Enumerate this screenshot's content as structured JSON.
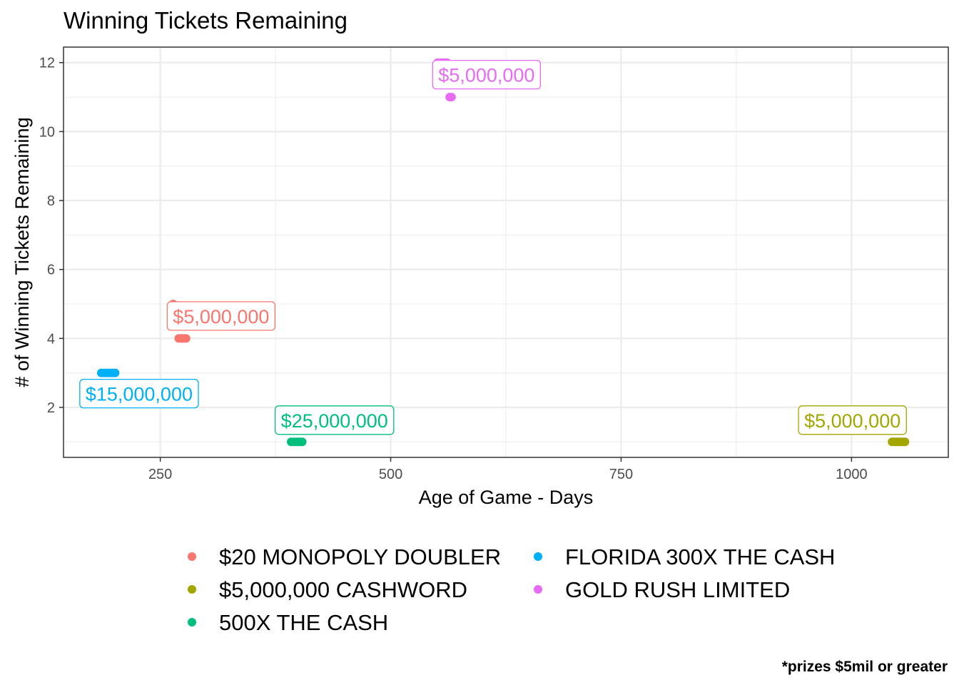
{
  "chart_data": {
    "type": "scatter",
    "title": "Winning Tickets Remaining",
    "xlabel": "Age of Game - Days",
    "ylabel": "# of Winning Tickets Remaining",
    "caption": "*prizes $5mil or greater",
    "xlim": [
      145,
      1105
    ],
    "ylim": [
      0.55,
      12.45
    ],
    "x_ticks": [
      250,
      500,
      750,
      1000
    ],
    "y_ticks": [
      2,
      4,
      6,
      8,
      10,
      12
    ],
    "grid": true,
    "legend_position": "bottom",
    "series": [
      {
        "name": "$20 MONOPOLY DOUBLER",
        "color": "#F8766D",
        "points": [
          [
            264,
            5
          ],
          [
            270,
            4
          ],
          [
            272,
            4
          ],
          [
            274,
            4
          ],
          [
            276,
            4
          ],
          [
            278,
            4
          ]
        ],
        "label": "$5,000,000",
        "label_anchor": [
          316,
          4.65
        ]
      },
      {
        "name": "$5,000,000 CASHWORD",
        "color": "#A3A500",
        "points": [
          [
            1044,
            1
          ],
          [
            1046,
            1
          ],
          [
            1048,
            1
          ],
          [
            1050,
            1
          ],
          [
            1052,
            1
          ],
          [
            1054,
            1
          ],
          [
            1056,
            1
          ],
          [
            1058,
            1
          ]
        ],
        "label": "$5,000,000",
        "label_anchor": [
          1001,
          1.63
        ]
      },
      {
        "name": "500X THE CASH",
        "color": "#00BF7D",
        "points": [
          [
            392,
            1
          ],
          [
            395,
            1
          ],
          [
            398,
            1
          ],
          [
            400,
            1
          ],
          [
            402,
            1
          ],
          [
            404,
            1
          ]
        ],
        "label": "$25,000,000",
        "label_anchor": [
          439,
          1.63
        ]
      },
      {
        "name": "FLORIDA 300X THE CASH",
        "color": "#00B0F6",
        "points": [
          [
            186,
            3
          ],
          [
            189,
            3
          ],
          [
            192,
            3
          ],
          [
            195,
            3
          ],
          [
            198,
            3
          ],
          [
            201,
            3
          ]
        ],
        "label": "$15,000,000",
        "label_anchor": [
          227,
          2.4
        ]
      },
      {
        "name": "GOLD RUSH LIMITED",
        "color": "#E76BF3",
        "points": [
          [
            551,
            12
          ],
          [
            555,
            12
          ],
          [
            558,
            12
          ],
          [
            561,
            12
          ],
          [
            564,
            11
          ],
          [
            566,
            11
          ]
        ],
        "label": "$5,000,000",
        "label_anchor": [
          604,
          11.65
        ]
      }
    ]
  }
}
